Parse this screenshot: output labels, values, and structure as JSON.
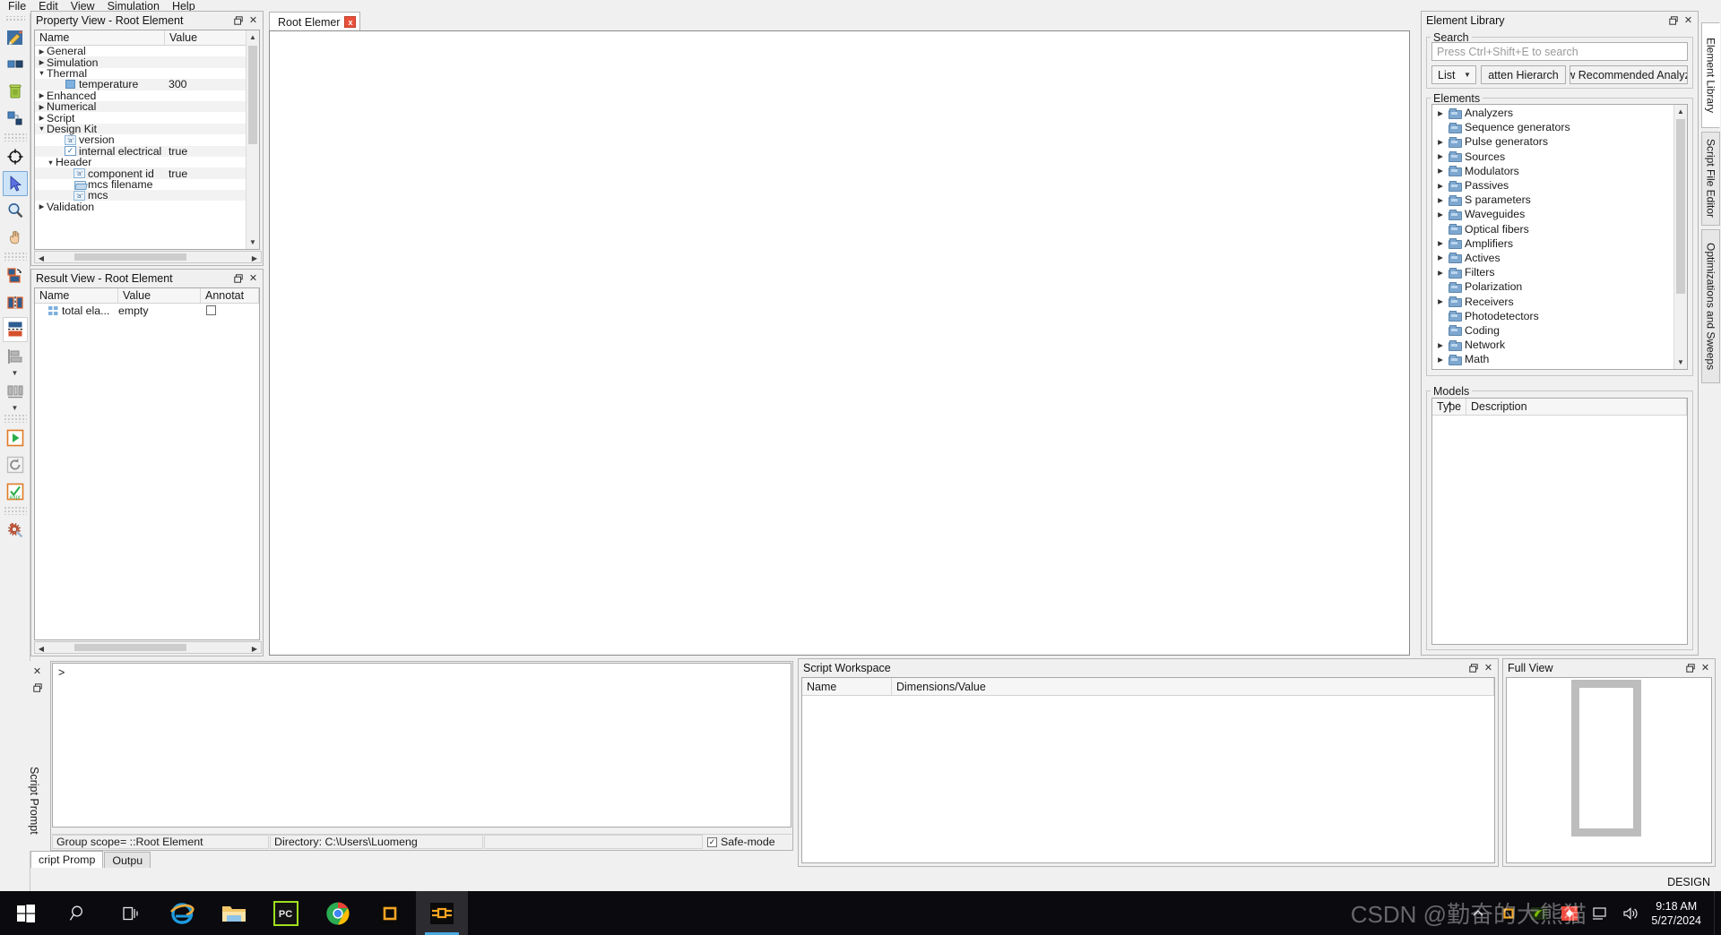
{
  "menu": {
    "items": [
      "File",
      "Edit",
      "View",
      "Simulation",
      "Help"
    ]
  },
  "left_toolbar": {
    "groups": [
      {
        "buttons": [
          {
            "name": "edit-element-button",
            "icon": "pencil-icon"
          },
          {
            "name": "new-compound-element-button",
            "icon": "two-squares-icon"
          },
          {
            "name": "delete-button",
            "icon": "trash-icon"
          },
          {
            "name": "group-elements-button",
            "icon": "group-squares-icon"
          }
        ]
      },
      {
        "buttons": [
          {
            "name": "target-tool-button",
            "icon": "crosshair-icon"
          },
          {
            "name": "select-tool-button",
            "icon": "cursor-arrow-icon",
            "selected": true
          },
          {
            "name": "zoom-tool-button",
            "icon": "magnifier-icon"
          },
          {
            "name": "pan-tool-button",
            "icon": "hand-icon"
          }
        ]
      },
      {
        "buttons": [
          {
            "name": "rotate-element-button",
            "icon": "rotate-shape-icon"
          },
          {
            "name": "flip-vertical-button",
            "icon": "flip-vertical-icon"
          },
          {
            "name": "flip-horizontal-button",
            "icon": "flip-horizontal-icon",
            "selected_white": true
          },
          {
            "name": "align-left-button",
            "icon": "align-left-icon"
          },
          {
            "name": "align-more-dropdown",
            "icon": "chevron-down-icon"
          },
          {
            "name": "distribute-button",
            "icon": "distribute-icon"
          },
          {
            "name": "distribute-more-dropdown",
            "icon": "chevron-down-icon"
          }
        ]
      },
      {
        "buttons": [
          {
            "name": "run-simulation-button",
            "icon": "play-icon"
          },
          {
            "name": "restart-button",
            "icon": "refresh-icon"
          },
          {
            "name": "expression-check-button",
            "icon": "expr-check-icon"
          }
        ]
      },
      {
        "buttons": [
          {
            "name": "move-tool-button",
            "icon": "move-wrench-icon"
          }
        ]
      }
    ]
  },
  "property_view": {
    "title": "Property View - Root Element",
    "columns": [
      "Name",
      "Value"
    ],
    "rows": [
      {
        "label": "General",
        "value": "",
        "indent": 0,
        "arrow": "closed",
        "icon": "none"
      },
      {
        "label": "Simulation",
        "value": "",
        "indent": 0,
        "arrow": "closed",
        "icon": "none"
      },
      {
        "label": "Thermal",
        "value": "",
        "indent": 0,
        "arrow": "open",
        "icon": "none"
      },
      {
        "label": "temperature",
        "value": "300",
        "indent": 2,
        "arrow": "none",
        "icon": "blue-square-icon"
      },
      {
        "label": "Enhanced",
        "value": "",
        "indent": 0,
        "arrow": "closed",
        "icon": "none"
      },
      {
        "label": "Numerical",
        "value": "",
        "indent": 0,
        "arrow": "closed",
        "icon": "none"
      },
      {
        "label": "Script",
        "value": "",
        "indent": 0,
        "arrow": "closed",
        "icon": "none"
      },
      {
        "label": "Design Kit",
        "value": "",
        "indent": 0,
        "arrow": "open",
        "icon": "none"
      },
      {
        "label": "version",
        "value": "",
        "indent": 2,
        "arrow": "none",
        "icon": "text-a-icon"
      },
      {
        "label": "internal electrical ...",
        "value": "true",
        "indent": 2,
        "arrow": "none",
        "icon": "checkbox-icon"
      },
      {
        "label": "Header",
        "value": "",
        "indent": 1,
        "arrow": "open",
        "icon": "none"
      },
      {
        "label": "component id",
        "value": "true",
        "indent": 3,
        "arrow": "none",
        "icon": "text-a-icon"
      },
      {
        "label": "mcs filename",
        "value": "",
        "indent": 3,
        "arrow": "none",
        "icon": "folder-open-icon"
      },
      {
        "label": "mcs",
        "value": "",
        "indent": 3,
        "arrow": "none",
        "icon": "text-a-icon"
      },
      {
        "label": "Validation",
        "value": "",
        "indent": 0,
        "arrow": "closed",
        "icon": "none"
      }
    ]
  },
  "result_view": {
    "title": "Result View - Root Element",
    "columns": [
      "Name",
      "Value",
      "Annotat"
    ],
    "rows": [
      {
        "name": "total ela...",
        "value": "empty",
        "annotate_checked": false
      }
    ]
  },
  "document_tabs": [
    {
      "label": "Root Elemer",
      "active": true,
      "close": "x"
    }
  ],
  "element_library": {
    "title": "Element Library",
    "search_group_label": "Search",
    "search_placeholder": "Press Ctrl+Shift+E to search",
    "view_mode": "List",
    "flatten_button": "atten Hierarch",
    "recommended_button": "w Recommended Analyz",
    "elements_group_label": "Elements",
    "tree": [
      {
        "label": "Analyzers",
        "expandable": true
      },
      {
        "label": "Sequence generators",
        "expandable": false
      },
      {
        "label": "Pulse generators",
        "expandable": true
      },
      {
        "label": "Sources",
        "expandable": true
      },
      {
        "label": "Modulators",
        "expandable": true
      },
      {
        "label": "Passives",
        "expandable": true
      },
      {
        "label": "S parameters",
        "expandable": true
      },
      {
        "label": "Waveguides",
        "expandable": true
      },
      {
        "label": "Optical fibers",
        "expandable": false
      },
      {
        "label": "Amplifiers",
        "expandable": true
      },
      {
        "label": "Actives",
        "expandable": true
      },
      {
        "label": "Filters",
        "expandable": true
      },
      {
        "label": "Polarization",
        "expandable": false
      },
      {
        "label": "Receivers",
        "expandable": true
      },
      {
        "label": "Photodetectors",
        "expandable": false
      },
      {
        "label": "Coding",
        "expandable": false
      },
      {
        "label": "Network",
        "expandable": true
      },
      {
        "label": "Math",
        "expandable": true
      }
    ],
    "models_group_label": "Models",
    "models_columns": [
      "Type",
      "Description"
    ],
    "models_rows": []
  },
  "right_rail_tabs": [
    {
      "label": "Element Library",
      "active": true
    },
    {
      "label": "Script File Editor",
      "active": false
    },
    {
      "label": "Optimizations and Sweeps",
      "active": false
    }
  ],
  "script_prompt": {
    "side_label": "Script Prompt",
    "prompt_char": ">",
    "status": {
      "group_scope": "Group scope= ::Root Element",
      "directory": "Directory: C:\\Users\\Luomeng",
      "blank": "",
      "safe_mode_label": "Safe-mode",
      "safe_mode_checked": true
    },
    "tabs": [
      {
        "label": "cript Promp",
        "active": true
      },
      {
        "label": "Outpu",
        "active": false
      }
    ]
  },
  "script_workspace": {
    "title": "Script Workspace",
    "columns": [
      "Name",
      "Dimensions/Value"
    ],
    "rows": []
  },
  "full_view": {
    "title": "Full View"
  },
  "status_mode": "DESIGN",
  "taskbar": {
    "apps": [
      {
        "name": "start-button",
        "icon": "windows-logo-icon",
        "running": false,
        "active": false
      },
      {
        "name": "search-button",
        "icon": "search-icon",
        "running": false,
        "active": false
      },
      {
        "name": "task-view-button",
        "icon": "task-view-icon",
        "running": false,
        "active": false
      },
      {
        "name": "internet-explorer-button",
        "icon": "internet-explorer-icon",
        "running": false,
        "active": false
      },
      {
        "name": "file-explorer-button",
        "icon": "file-explorer-icon",
        "running": true,
        "active": false
      },
      {
        "name": "pycharm-button",
        "icon": "pycharm-icon",
        "running": false,
        "active": false
      },
      {
        "name": "chrome-button",
        "icon": "chrome-icon",
        "running": true,
        "active": false
      },
      {
        "name": "lumerical-fdtd-button",
        "icon": "orange-square-icon",
        "running": true,
        "active": false
      },
      {
        "name": "interconnect-button",
        "icon": "interconnect-icon",
        "running": true,
        "active": true
      }
    ],
    "tray": [
      {
        "name": "show-hidden-icons-button",
        "icon": "chevron-up-icon"
      },
      {
        "name": "lumerical-tray-icon",
        "icon": "orange-square-icon"
      },
      {
        "name": "nvidia-tray-icon",
        "icon": "nvidia-icon"
      },
      {
        "name": "flash-tray-icon",
        "icon": "red-diamond-icon"
      },
      {
        "name": "network-tray-icon",
        "icon": "monitor-icon"
      },
      {
        "name": "volume-tray-icon",
        "icon": "speaker-icon"
      }
    ],
    "clock_time": "9:18 AM",
    "clock_date": "5/27/2024",
    "watermark": "CSDN @勤奋的大熊猫"
  }
}
